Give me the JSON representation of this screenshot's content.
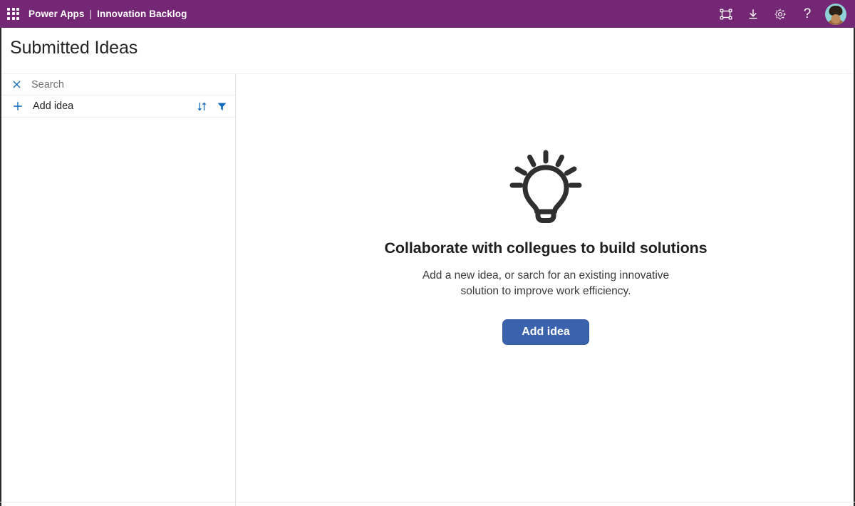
{
  "topbar": {
    "waffle_label": "app-launcher",
    "brand": "Power Apps",
    "separator": "|",
    "app_name": "Innovation Backlog",
    "actions": [
      {
        "name": "fit-to-screen-icon",
        "label": "Fit to screen"
      },
      {
        "name": "download-icon",
        "label": "Download"
      },
      {
        "name": "settings-icon",
        "label": "Settings"
      },
      {
        "name": "help-icon",
        "label": "?"
      }
    ],
    "avatar_label": "User account"
  },
  "page": {
    "title": "Submitted Ideas"
  },
  "left_panel": {
    "search": {
      "clear_icon": "close-icon",
      "placeholder": "Search",
      "value": ""
    },
    "add_row": {
      "icon": "plus-icon",
      "label": "Add idea",
      "tools": [
        {
          "name": "sort-icon",
          "label": "Sort"
        },
        {
          "name": "filter-icon",
          "label": "Filter"
        }
      ]
    },
    "items": []
  },
  "main": {
    "illustration": "lightbulb-icon",
    "title": "Collaborate with collegues to build solutions",
    "subtitle": "Add a new idea, or sarch for an existing innovative solution to improve work efficiency.",
    "primary_button": "Add idea"
  },
  "colors": {
    "brand_purple": "#742774",
    "accent_blue": "#0f6cbd",
    "button_blue": "#3b63ad",
    "text_dark": "#201f1e",
    "placeholder_gray": "#707070"
  }
}
